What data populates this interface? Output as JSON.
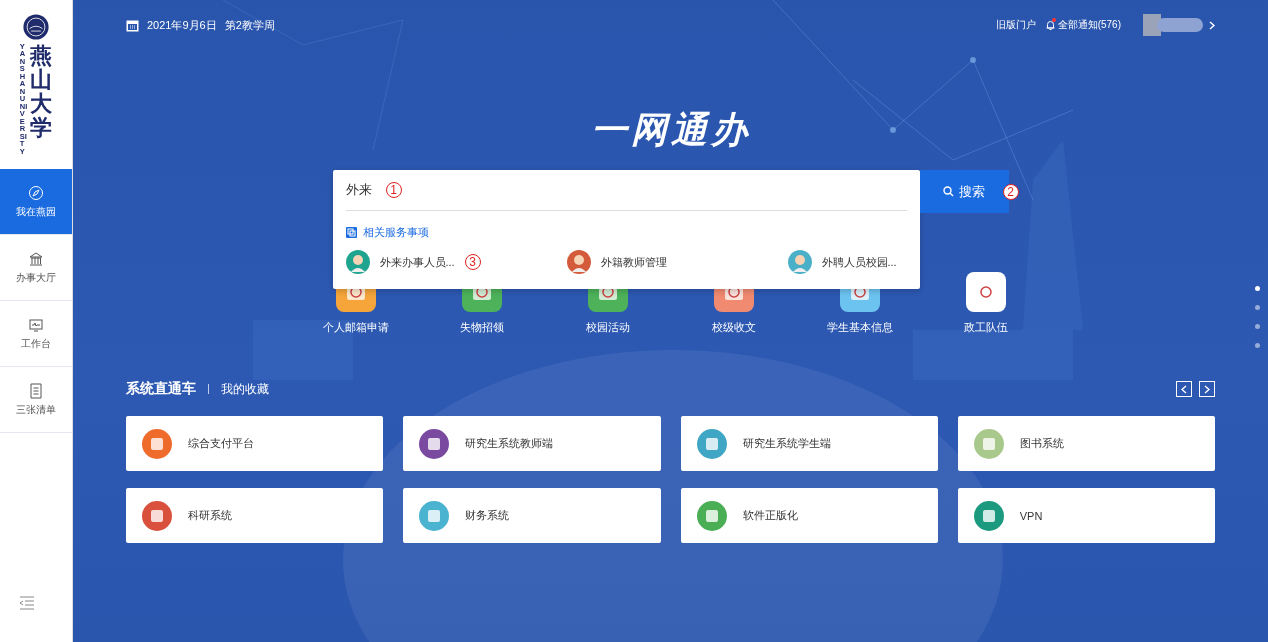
{
  "sidebar": {
    "logo": {
      "name": "燕山大学",
      "latin": "YANSHAN UNIVERSITY"
    },
    "items": [
      {
        "label": "我在燕园",
        "kind": "compass",
        "selected": true
      },
      {
        "label": "办事大厅",
        "kind": "hall",
        "selected": false
      },
      {
        "label": "工作台",
        "kind": "desk",
        "selected": false
      },
      {
        "label": "三张清单",
        "kind": "list",
        "selected": false
      }
    ]
  },
  "topbar": {
    "date": "2021年9月6日",
    "week": "第2教学周",
    "links": [
      "旧版门户"
    ],
    "notifications": "全部通知(576)",
    "has_unread": true
  },
  "title": "一网通办",
  "search": {
    "value": "外来",
    "value_marker": "1",
    "button": "搜索",
    "button_marker": "2",
    "dropdown": {
      "heading": "相关服务事项",
      "results": [
        {
          "label": "外来办事人员...",
          "color": "#1fa58f",
          "marker": "3"
        },
        {
          "label": "外籍教师管理",
          "color": "#d35a3a"
        },
        {
          "label": "外聘人员校园...",
          "color": "#4ab0c8"
        }
      ]
    }
  },
  "quick_apps": [
    {
      "label": "个人邮箱申请",
      "color": "#f5a53a",
      "partly_hidden": true
    },
    {
      "label": "失物招领",
      "color": "#4db25a",
      "partly_hidden": true
    },
    {
      "label": "校园活动",
      "color": "#4db25a",
      "partly_hidden": true
    },
    {
      "label": "校级收文",
      "color": "#f08a70",
      "partly_hidden": true
    },
    {
      "label": "学生基本信息",
      "color": "#6cc3f0",
      "partly_hidden": true
    },
    {
      "label": "政工队伍",
      "color": "#ffffff",
      "partly_hidden": false
    }
  ],
  "systems": {
    "tabs": [
      {
        "label": "系统直通车",
        "selected": true
      },
      {
        "label": "我的收藏",
        "selected": false
      }
    ],
    "cards": [
      {
        "label": "综合支付平台",
        "color": "#ef6b2c"
      },
      {
        "label": "研究生系统教师端",
        "color": "#7a4aa0"
      },
      {
        "label": "研究生系统学生端",
        "color": "#3fa7c4"
      },
      {
        "label": "图书系统",
        "color": "#a9c98c"
      },
      {
        "label": "科研系统",
        "color": "#d9503c"
      },
      {
        "label": "财务系统",
        "color": "#49b3d0"
      },
      {
        "label": "软件正版化",
        "color": "#4aae55"
      },
      {
        "label": "VPN",
        "color": "#1b9a80"
      }
    ]
  },
  "page_dots": [
    {
      "selected": true
    },
    {
      "selected": false
    },
    {
      "selected": false
    },
    {
      "selected": false
    }
  ]
}
